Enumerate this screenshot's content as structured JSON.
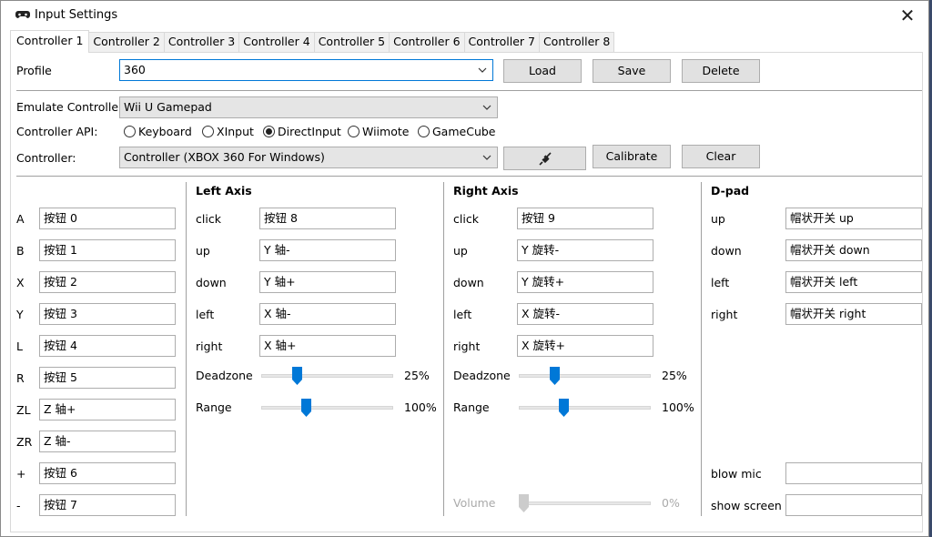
{
  "window": {
    "title": "Input Settings",
    "close_symbol": "✕"
  },
  "tabs": [
    "Controller 1",
    "Controller 2",
    "Controller 3",
    "Controller 4",
    "Controller 5",
    "Controller 6",
    "Controller 7",
    "Controller 8"
  ],
  "profile": {
    "label": "Profile",
    "value": "360",
    "load": "Load",
    "save": "Save",
    "delete": "Delete"
  },
  "emulate": {
    "label": "Emulate Controller",
    "value": "Wii U Gamepad"
  },
  "api": {
    "label": "Controller API:",
    "options": [
      "Keyboard",
      "XInput",
      "DirectInput",
      "Wiimote",
      "GameCube"
    ],
    "selected": "DirectInput"
  },
  "controller": {
    "label": "Controller:",
    "value": "Controller (XBOX 360 For Windows)",
    "calibrate": "Calibrate",
    "clear": "Clear"
  },
  "buttons": [
    {
      "label": "A",
      "value": "按钮 0"
    },
    {
      "label": "B",
      "value": "按钮 1"
    },
    {
      "label": "X",
      "value": "按钮 2"
    },
    {
      "label": "Y",
      "value": "按钮 3"
    },
    {
      "label": "L",
      "value": "按钮 4"
    },
    {
      "label": "R",
      "value": "按钮 5"
    },
    {
      "label": "ZL",
      "value": "Z 轴+"
    },
    {
      "label": "ZR",
      "value": "Z 轴-"
    },
    {
      "label": "+",
      "value": "按钮 6"
    },
    {
      "label": "-",
      "value": "按钮 7"
    }
  ],
  "left_axis": {
    "title": "Left Axis",
    "rows": [
      {
        "label": "click",
        "value": "按钮 8"
      },
      {
        "label": "up",
        "value": "Y 轴-"
      },
      {
        "label": "down",
        "value": "Y 轴+"
      },
      {
        "label": "left",
        "value": "X 轴-"
      },
      {
        "label": "right",
        "value": "X 轴+"
      }
    ],
    "deadzone_label": "Deadzone",
    "deadzone_value": "25%",
    "deadzone_fraction": 0.25,
    "range_label": "Range",
    "range_value": "100%",
    "range_fraction": 0.33
  },
  "right_axis": {
    "title": "Right Axis",
    "rows": [
      {
        "label": "click",
        "value": "按钮 9"
      },
      {
        "label": "up",
        "value": "Y 旋转-"
      },
      {
        "label": "down",
        "value": "Y 旋转+"
      },
      {
        "label": "left",
        "value": "X 旋转-"
      },
      {
        "label": "right",
        "value": "X 旋转+"
      }
    ],
    "deadzone_label": "Deadzone",
    "deadzone_value": "25%",
    "deadzone_fraction": 0.25,
    "range_label": "Range",
    "range_value": "100%",
    "range_fraction": 0.33,
    "volume_label": "Volume",
    "volume_value": "0%",
    "volume_fraction": 0
  },
  "dpad": {
    "title": "D-pad",
    "rows": [
      {
        "label": "up",
        "value": "帽状开关 up"
      },
      {
        "label": "down",
        "value": "帽状开关 down"
      },
      {
        "label": "left",
        "value": "帽状开关 left"
      },
      {
        "label": "right",
        "value": "帽状开关 right"
      }
    ],
    "blow_mic_label": "blow mic",
    "blow_mic_value": "",
    "show_screen_label": "show screen",
    "show_screen_value": ""
  },
  "colors": {
    "accent": "#0078d7"
  }
}
